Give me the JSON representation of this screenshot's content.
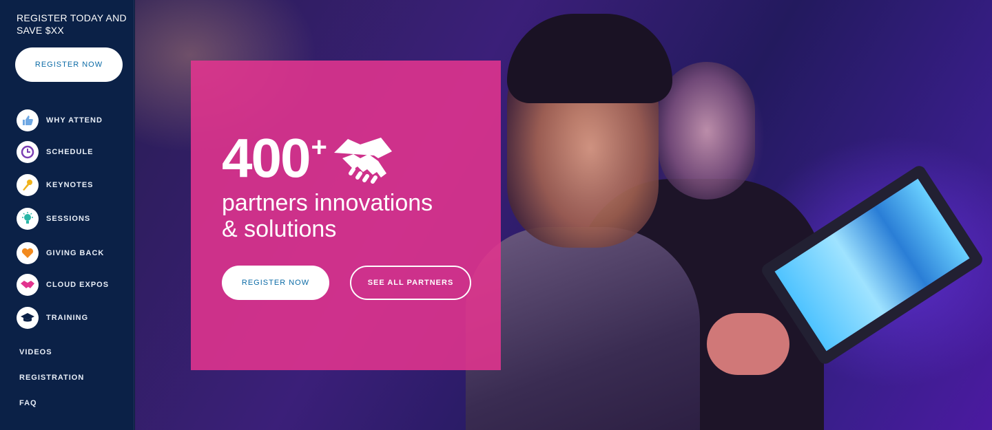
{
  "sidebar": {
    "promo": "REGISTER TODAY AND SAVE $XX",
    "register_label": "REGISTER NOW",
    "items": [
      {
        "label": "WHY ATTEND",
        "icon": "thumbs-up-icon"
      },
      {
        "label": "SCHEDULE",
        "icon": "clock-icon"
      },
      {
        "label": "KEYNOTES",
        "icon": "microphone-icon"
      },
      {
        "label": "SESSIONS",
        "icon": "lightbulb-icon"
      },
      {
        "label": "GIVING BACK",
        "icon": "heart-icon"
      },
      {
        "label": "CLOUD EXPOS",
        "icon": "handshake-icon"
      },
      {
        "label": "TRAINING",
        "icon": "graduation-cap-icon"
      }
    ],
    "links": [
      "VIDEOS",
      "REGISTRATION",
      "FAQ"
    ]
  },
  "hero": {
    "number": "400",
    "plus": "+",
    "subtitle_line1": "partners innovations",
    "subtitle_line2": "& solutions",
    "primary_button": "REGISTER NOW",
    "secondary_button": "SEE ALL PARTNERS",
    "card_color": "#e2348e"
  },
  "colors": {
    "sidebar_bg": "#0b2147",
    "button_text": "#0a6aa6"
  }
}
